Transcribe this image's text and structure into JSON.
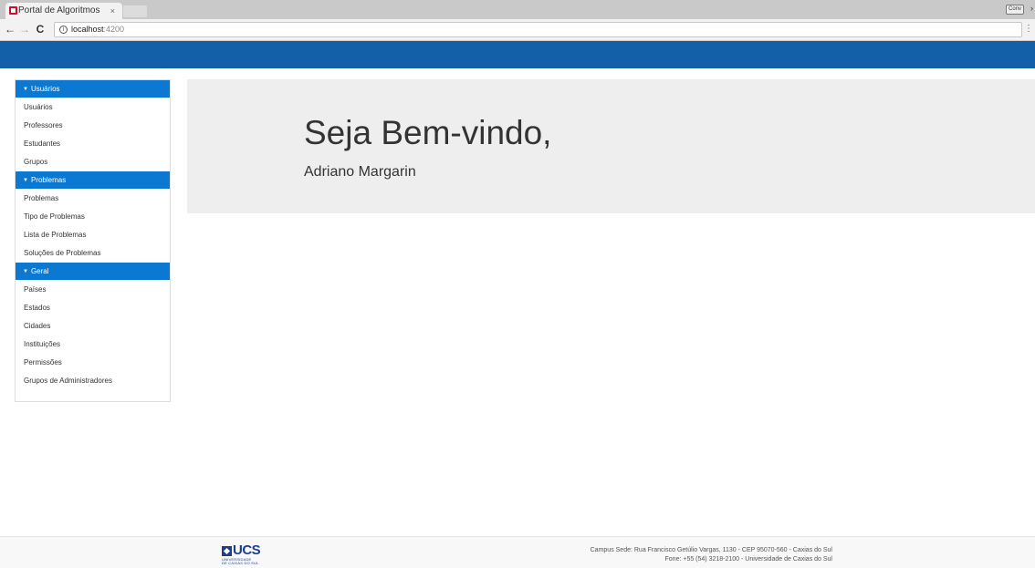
{
  "browser": {
    "tab_title": "Portal de Algoritmos",
    "tab_close": "×",
    "profile_label": "Conv",
    "back_icon": "←",
    "forward_icon": "→",
    "reload_icon": "C",
    "info_icon": "i",
    "url_host": "localhost",
    "url_port": ":4200",
    "menu_icon": "⋮"
  },
  "colors": {
    "header": "#1360a8",
    "group_header": "#0b78d1",
    "jumbotron": "#eeeeee"
  },
  "sidebar": {
    "groups": [
      {
        "label": "Usuários",
        "items": [
          "Usuários",
          "Professores",
          "Estudantes",
          "Grupos"
        ]
      },
      {
        "label": "Problemas",
        "items": [
          "Problemas",
          "Tipo de Problemas",
          "Lista de Problemas",
          "Soluções de Problemas"
        ]
      },
      {
        "label": "Geral",
        "items": [
          "Países",
          "Estados",
          "Cidades",
          "Instituições",
          "Permissões",
          "Grupos de Administradores"
        ]
      }
    ]
  },
  "welcome": {
    "title": "Seja Bem-vindo,",
    "user": "Adriano Margarin"
  },
  "footer": {
    "logo_text": "UCS",
    "logo_sub1": "UNIVERSIDADE",
    "logo_sub2": "DE CAXIAS DO SUL",
    "address": "Campus Sede: Rua Francisco Getúlio Vargas, 1130 - CEP 95070-560 - Caxias do Sul",
    "phone": "Fone: +55 (54) 3218-2100 - Universidade de Caxias do Sul"
  }
}
